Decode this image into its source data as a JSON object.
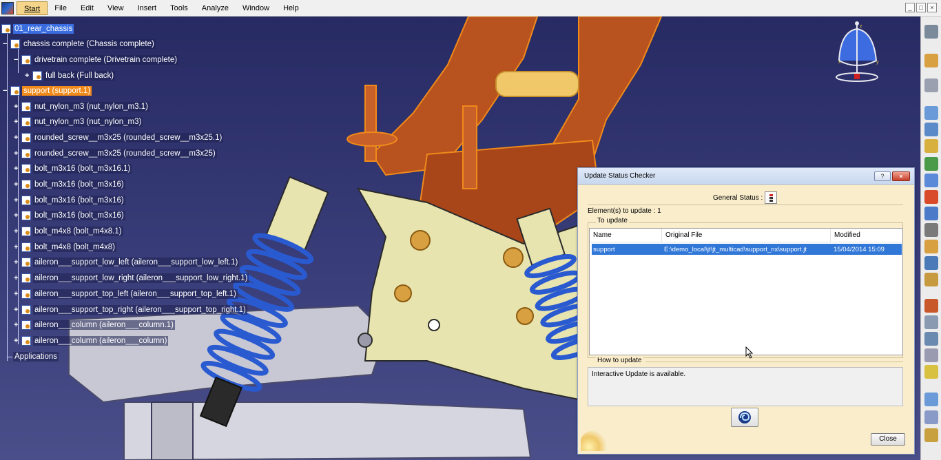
{
  "menubar": {
    "items": [
      "Start",
      "File",
      "Edit",
      "View",
      "Insert",
      "Tools",
      "Analyze",
      "Window",
      "Help"
    ],
    "window_controls": [
      "_",
      "□",
      "×"
    ]
  },
  "tree": {
    "root": "01_rear_chassis",
    "items": [
      "chassis complete (Chassis complete)",
      "drivetrain complete (Drivetrain complete)",
      "full back (Full back)",
      "support (support.1)",
      "nut_nylon_m3 (nut_nylon_m3.1)",
      "nut_nylon_m3 (nut_nylon_m3)",
      "rounded_screw__m3x25 (rounded_screw__m3x25.1)",
      "rounded_screw__m3x25 (rounded_screw__m3x25)",
      "bolt_m3x16 (bolt_m3x16.1)",
      "bolt_m3x16 (bolt_m3x16)",
      "bolt_m3x16 (bolt_m3x16)",
      "bolt_m3x16 (bolt_m3x16)",
      "bolt_m4x8 (bolt_m4x8.1)",
      "bolt_m4x8 (bolt_m4x8)",
      "aileron___support_low_left (aileron___support_low_left.1)",
      "aileron___support_low_right (aileron___support_low_right.1)",
      "aileron___support_top_left (aileron___support_top_left.1)",
      "aileron___support_top_right (aileron___support_top_right.1)",
      "aileron___column (aileron___column.1)",
      "aileron___column (aileron___column)"
    ],
    "applications": "Applications"
  },
  "compass": {
    "axis_labels": [
      "x",
      "y",
      "z"
    ]
  },
  "dialog": {
    "title": "Update Status Checker",
    "help_label": "?",
    "close_icon_label": "×",
    "general_status_label": "General Status :",
    "elements_to_update": "Element(s) to update : 1",
    "to_update_group": "To update",
    "columns": [
      "Name",
      "Original File",
      "Modified"
    ],
    "rows": [
      {
        "name": "support",
        "file": "E:\\demo_local\\jt\\jt_multicad\\support_nx\\support.jt",
        "modified": "15/04/2014 15:09"
      }
    ],
    "how_to_update_group": "How to update",
    "how_to_update_text": "Interactive Update is available.",
    "close_button": "Close"
  },
  "colors": {
    "selection_blue": "#3077d8",
    "support_highlight": "#f08a1a",
    "dialog_bg": "#f9edcc",
    "viewport_bg": "#2e3168"
  }
}
